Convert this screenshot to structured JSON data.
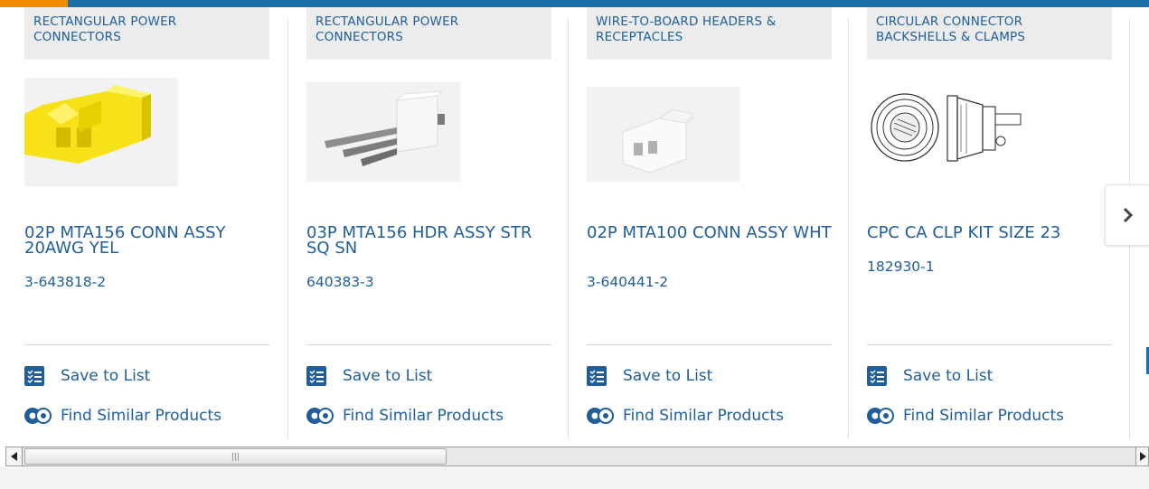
{
  "products": [
    {
      "category": "RECTANGULAR POWER CONNECTORS",
      "title": "02P MTA156 CONN ASSY 20AWG YEL",
      "part_number": "3-643818-2",
      "save_label": "Save to List",
      "similar_label": "Find Similar Products",
      "image": "yellow-2pos-connector-housing"
    },
    {
      "category": "RECTANGULAR POWER CONNECTORS",
      "title": "03P MTA156 HDR ASSY STR SQ SN",
      "part_number": "640383-3",
      "save_label": "Save to List",
      "similar_label": "Find Similar Products",
      "image": "white-3pin-header"
    },
    {
      "category": "WIRE-TO-BOARD HEADERS & RECEPTACLES",
      "title": "02P MTA100 CONN ASSY WHT",
      "part_number": "3-640441-2",
      "save_label": "Save to List",
      "similar_label": "Find Similar Products",
      "image": "white-2pos-connector"
    },
    {
      "category": "CIRCULAR CONNECTOR BACKSHELLS & CLAMPS",
      "title": "CPC CA CLP KIT SIZE 23",
      "part_number": "182930-1",
      "save_label": "Save to List",
      "similar_label": "Find Similar Products",
      "image": "circular-clamp-line-drawing"
    }
  ],
  "colors": {
    "accent_orange": "#f28c00",
    "brand_blue": "#1a6fa8",
    "link_blue": "#1f5e9a",
    "category_bg": "#ececec"
  },
  "icons": {
    "save": "checklist-icon",
    "similar": "gears-icon",
    "next": "chevron-right-icon"
  }
}
